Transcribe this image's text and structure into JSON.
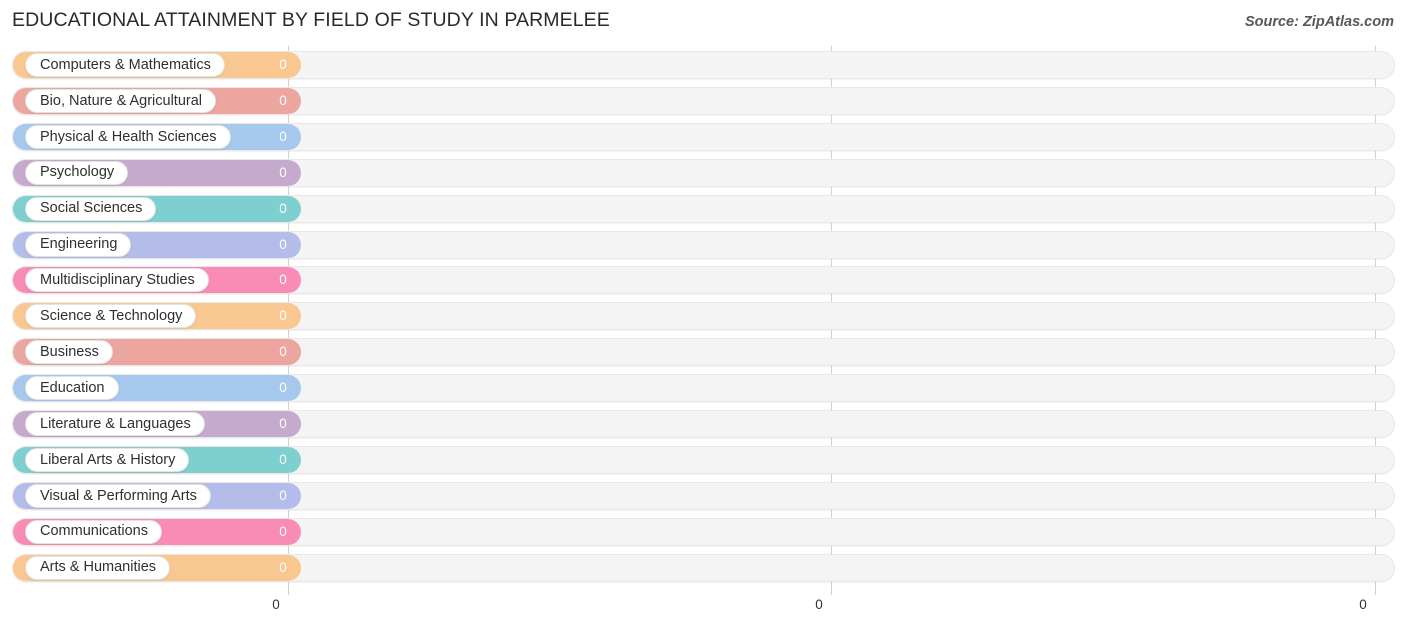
{
  "header": {
    "title": "EDUCATIONAL ATTAINMENT BY FIELD OF STUDY IN PARMELEE",
    "source": "Source: ZipAtlas.com"
  },
  "chart_data": {
    "type": "bar",
    "orientation": "horizontal",
    "title": "EDUCATIONAL ATTAINMENT BY FIELD OF STUDY IN PARMELEE",
    "xlabel": "",
    "ylabel": "",
    "xlim": [
      0,
      0
    ],
    "grid": true,
    "legend": "none",
    "axis_ticks": [
      "0",
      "0",
      "0"
    ],
    "categories": [
      "Computers & Mathematics",
      "Bio, Nature & Agricultural",
      "Physical & Health Sciences",
      "Psychology",
      "Social Sciences",
      "Engineering",
      "Multidisciplinary Studies",
      "Science & Technology",
      "Business",
      "Education",
      "Literature & Languages",
      "Liberal Arts & History",
      "Visual & Performing Arts",
      "Communications",
      "Arts & Humanities"
    ],
    "values": [
      0,
      0,
      0,
      0,
      0,
      0,
      0,
      0,
      0,
      0,
      0,
      0,
      0,
      0,
      0
    ],
    "value_labels": [
      "0",
      "0",
      "0",
      "0",
      "0",
      "0",
      "0",
      "0",
      "0",
      "0",
      "0",
      "0",
      "0",
      "0",
      "0"
    ],
    "colors": [
      "#f8c890",
      "#eda5a0",
      "#a6c8ec",
      "#c6aacd",
      "#7dd0cf",
      "#b4bdea",
      "#f98cb4",
      "#f9c890",
      "#eda5a0",
      "#a6c8ec",
      "#c6aacd",
      "#7dd0cf",
      "#b4bdea",
      "#f98cb4",
      "#f9c890"
    ]
  }
}
